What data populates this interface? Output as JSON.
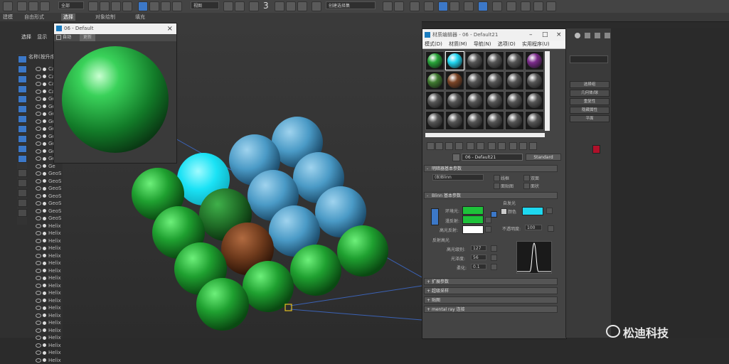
{
  "toolbar": {
    "dropdown_all": "全部",
    "dropdown_view": "视图",
    "dropdown_selection": "创建选择集",
    "num_label": "3"
  },
  "ribbon": {
    "items": [
      "建模",
      "自由形式",
      "选择",
      "对象绘制",
      "填充"
    ],
    "active_index": 2
  },
  "scene_explorer": {
    "tab_select": "选择",
    "tab_display": "显示",
    "header": "名称(按升序排序)",
    "rows": [
      "Ca",
      "Ca",
      "Ca",
      "Ca",
      "Ge",
      "Ge",
      "Ge",
      "Ge",
      "Ge",
      "Ge",
      "Ge",
      "Ge",
      "Ge",
      "Ge",
      "GeoS",
      "GeoS",
      "GeoS",
      "GeoS",
      "GeoS",
      "GeoS",
      "GeoS",
      "Helix",
      "Helix",
      "Helix",
      "Helix",
      "Helix",
      "Helix",
      "Helix",
      "Helix",
      "Helix",
      "Helix",
      "Helix",
      "Helix",
      "Helix",
      "Helix",
      "Helix",
      "Helix",
      "Helix",
      "Helix",
      "Helix"
    ]
  },
  "preview_window": {
    "title": "06 - Default",
    "auto_label": "自动",
    "update_label": "更新"
  },
  "material_editor": {
    "title": "材质编辑器 - 06 - Default21",
    "menu": [
      "模式(D)",
      "材质(M)",
      "导航(N)",
      "选项(O)",
      "实用程序(U)"
    ],
    "slot_colors": [
      [
        "#27a338",
        "#20d6f0",
        "#555555",
        "#555555",
        "#555555",
        "#7a2a8a"
      ],
      [
        "#3f7a30",
        "#7a4426",
        "#555555",
        "#555555",
        "#555555",
        "#555555"
      ],
      [
        "#555555",
        "#555555",
        "#555555",
        "#555555",
        "#555555",
        "#555555"
      ],
      [
        "#555555",
        "#555555",
        "#555555",
        "#555555",
        "#555555",
        "#555555"
      ]
    ],
    "material_name": "06 - Default21",
    "material_type": "Standard",
    "shader_rollout": "明暗器基本参数",
    "shader_value": "(B)Blinn",
    "shader_opts": [
      "线框",
      "双面",
      "面贴图",
      "面状"
    ],
    "blinn_rollout": "Blinn 基本参数",
    "self_illum_label": "自发光",
    "color_label": "颜色",
    "ambient_label": "环境光:",
    "diffuse_label": "漫反射:",
    "specular_label": "高光反射:",
    "opacity_label": "不透明度:",
    "opacity_value": "100",
    "highlight_label": "反射高光",
    "spec_level_label": "高光级别:",
    "spec_level_value": "127",
    "gloss_label": "光泽度:",
    "gloss_value": "56",
    "soften_label": "柔化:",
    "soften_value": "0.1",
    "rollouts_bottom": [
      "扩展参数",
      "超级采样",
      "贴图",
      "mental ray 连接"
    ],
    "colors": {
      "ambient": "#1ec23a",
      "diffuse": "#1ec23a",
      "specular": "#ffffff",
      "self_illum": "#1ed8f0"
    }
  },
  "command_panel": {
    "buttons": [
      "选择组",
      "几何体/球",
      "重复性",
      "隐藏属性",
      "平面"
    ]
  },
  "watermark": "松迪科技"
}
